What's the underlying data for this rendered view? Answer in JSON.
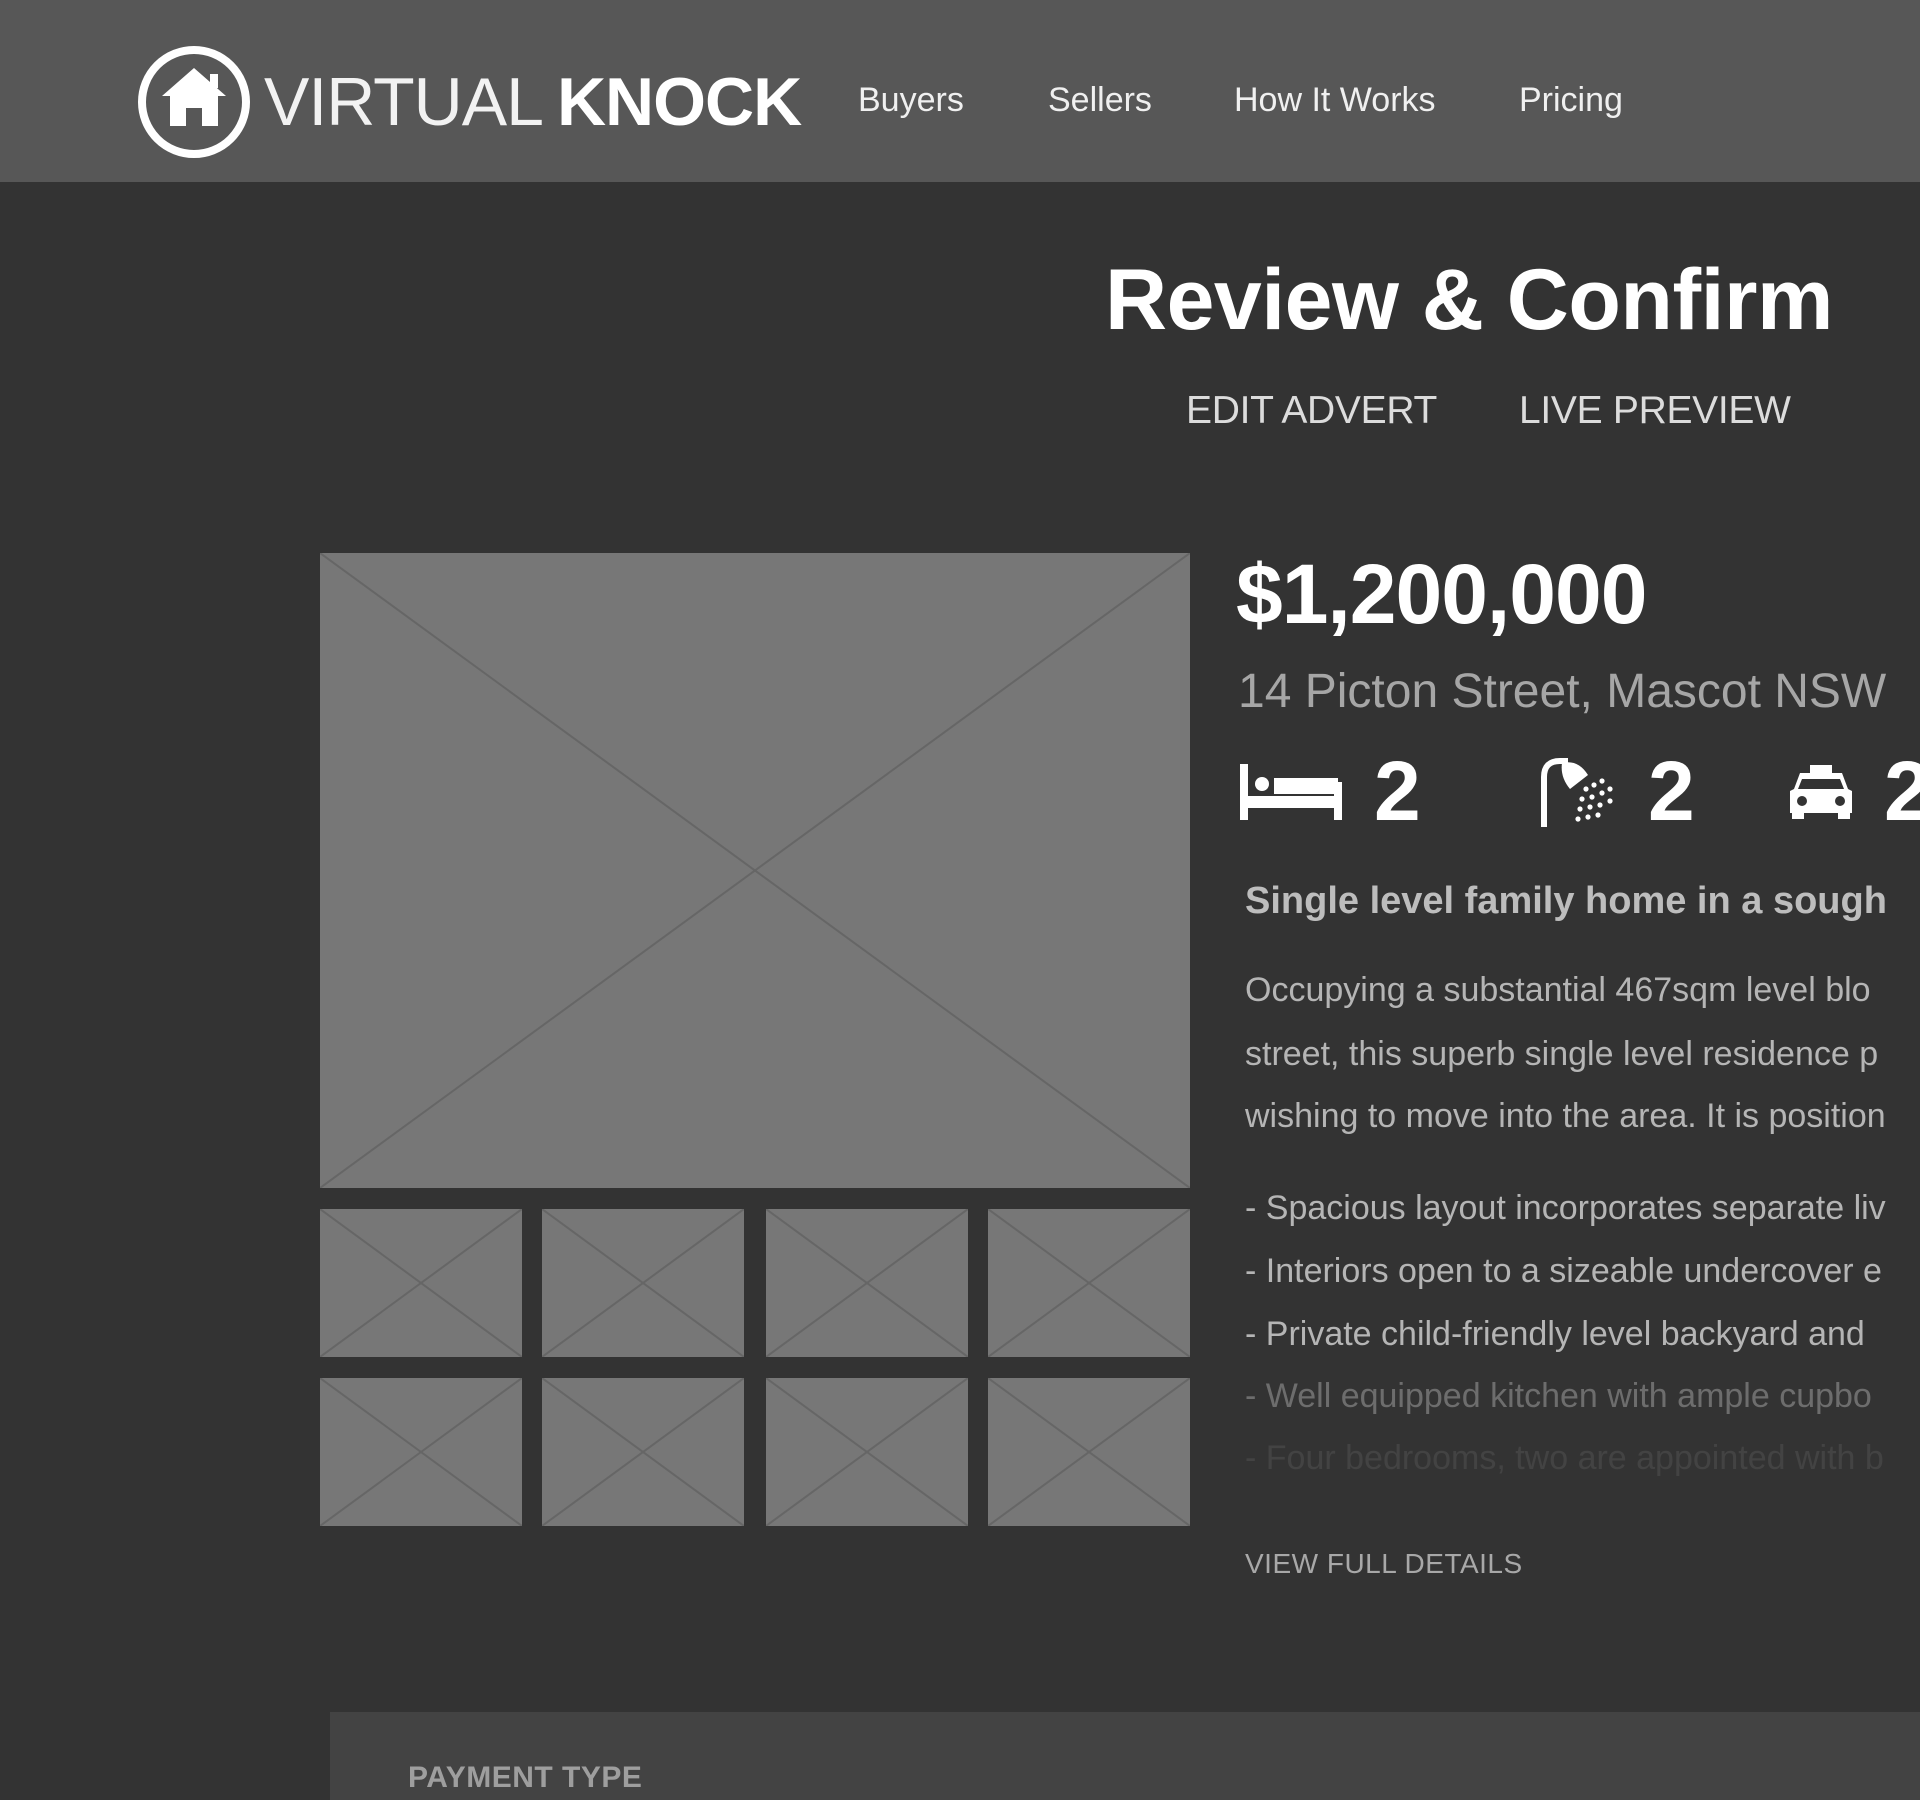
{
  "brand": {
    "name_light": "VIRTUAL",
    "name_bold": "KNOCK",
    "logo_icon": "house-icon"
  },
  "nav": {
    "items": [
      {
        "label": "Buyers"
      },
      {
        "label": "Sellers"
      },
      {
        "label": "How It Works"
      },
      {
        "label": "Pricing"
      }
    ]
  },
  "page": {
    "title": "Review & Confirm",
    "tabs": [
      {
        "label": "EDIT ADVERT"
      },
      {
        "label": "LIVE PREVIEW"
      }
    ]
  },
  "gallery": {
    "main_image": "image-placeholder",
    "thumbnails": 8
  },
  "listing": {
    "price": "$1,200,000",
    "address": "14 Picton Street, Mascot NSW",
    "features": [
      {
        "icon": "bed-icon",
        "count": "2"
      },
      {
        "icon": "shower-icon",
        "count": "2"
      },
      {
        "icon": "car-icon",
        "count": "2"
      }
    ],
    "headline": "Single level family home in a sough",
    "description": [
      "Occupying a substantial 467sqm level blo",
      "street, this superb single level residence p",
      "wishing to move into the area. It is position"
    ],
    "bullets": [
      "- Spacious layout incorporates separate liv",
      "- Interiors open to a sizeable undercover e",
      "- Private child-friendly level backyard and",
      "- Well equipped kitchen with ample cupbo",
      "- Four bedrooms, two are appointed with b"
    ],
    "view_full_label": "VIEW FULL DETAILS"
  },
  "payment": {
    "section_label": "PAYMENT TYPE"
  },
  "colors": {
    "header_bg": "#575757",
    "page_bg": "#333333",
    "placeholder": "#777777",
    "panel_bg": "#434343"
  }
}
